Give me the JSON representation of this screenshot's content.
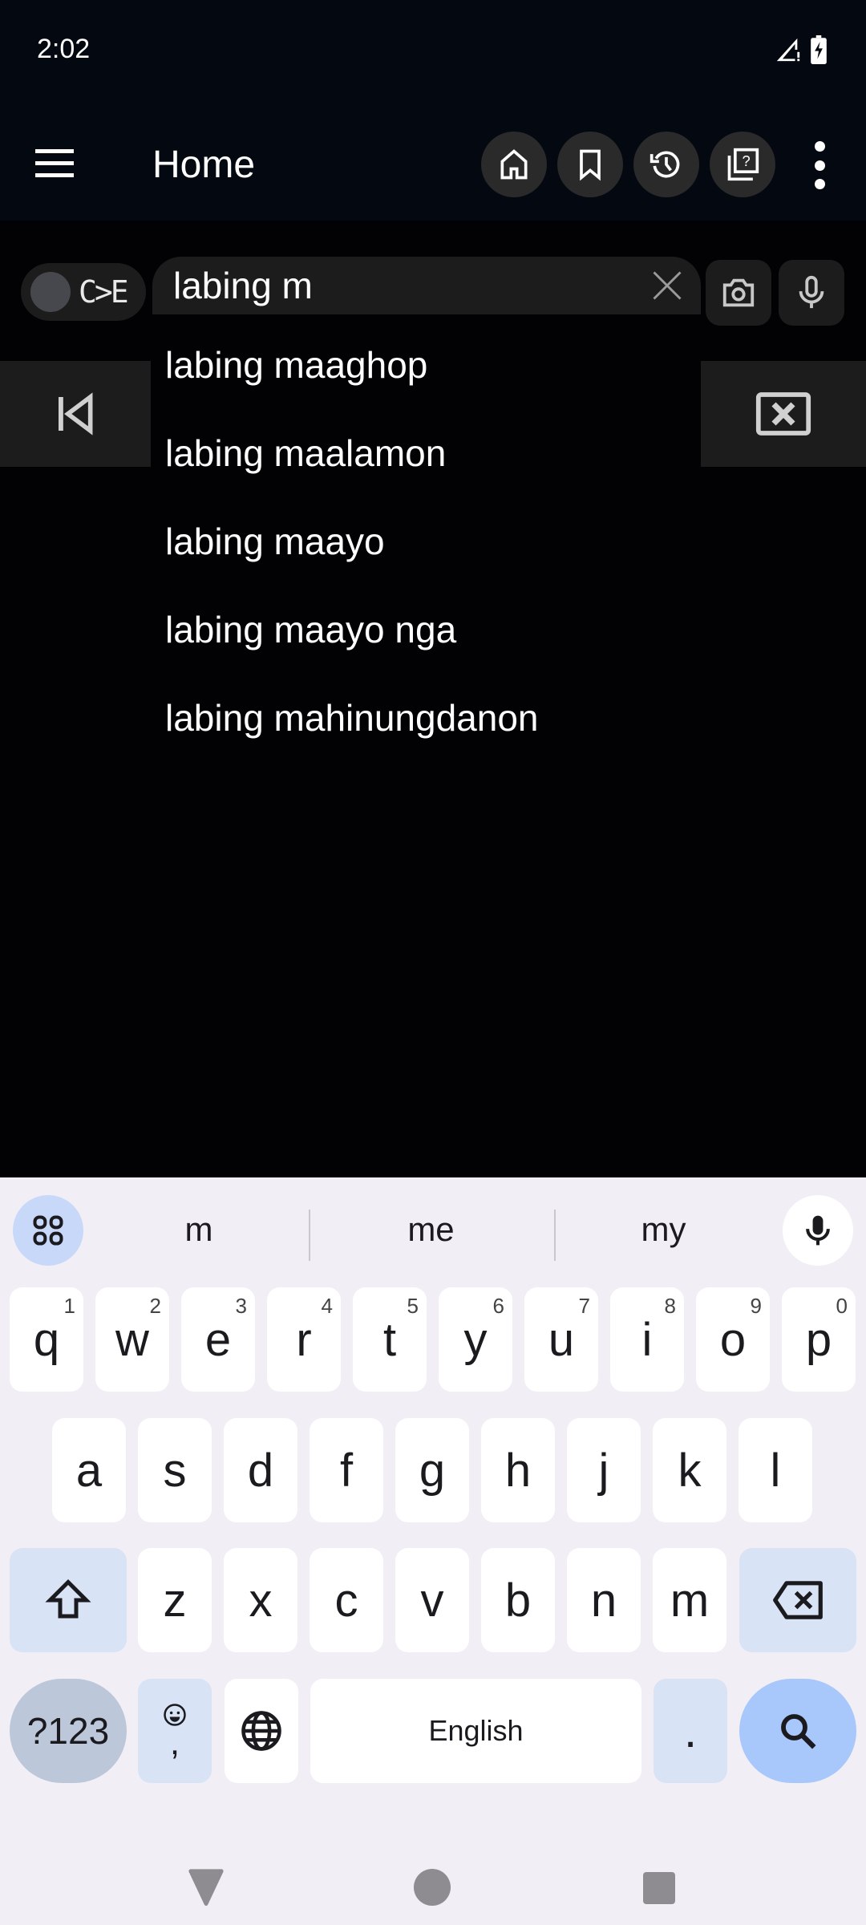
{
  "status": {
    "time": "2:02",
    "icons": [
      "signal-alert-icon",
      "battery-charging-icon"
    ]
  },
  "appbar": {
    "title": "Home",
    "actions": [
      "home-icon",
      "bookmark-icon",
      "history-icon",
      "quiz-icon",
      "more-vert-icon"
    ]
  },
  "search": {
    "direction_toggle": "C>E",
    "value": "labing m",
    "buttons": [
      "camera-icon",
      "mic-icon"
    ]
  },
  "suggestions": [
    "labing maaghop",
    "labing maalamon",
    "labing maayo",
    "labing maayo nga",
    "labing mahinungdanon"
  ],
  "keyboard": {
    "suggestions": [
      "m",
      "me",
      "my"
    ],
    "row1": [
      {
        "k": "q",
        "h": "1"
      },
      {
        "k": "w",
        "h": "2"
      },
      {
        "k": "e",
        "h": "3"
      },
      {
        "k": "r",
        "h": "4"
      },
      {
        "k": "t",
        "h": "5"
      },
      {
        "k": "y",
        "h": "6"
      },
      {
        "k": "u",
        "h": "7"
      },
      {
        "k": "i",
        "h": "8"
      },
      {
        "k": "o",
        "h": "9"
      },
      {
        "k": "p",
        "h": "0"
      }
    ],
    "row2": [
      "a",
      "s",
      "d",
      "f",
      "g",
      "h",
      "j",
      "k",
      "l"
    ],
    "row3": [
      "z",
      "x",
      "c",
      "v",
      "b",
      "n",
      "m"
    ],
    "symbols_label": "?123",
    "comma_label": ",",
    "space_label": "English",
    "period_label": "."
  },
  "colors": {
    "accent": "#a8c7fa",
    "key_mod": "#d8e3f6",
    "panel": "#1c1c1c"
  }
}
